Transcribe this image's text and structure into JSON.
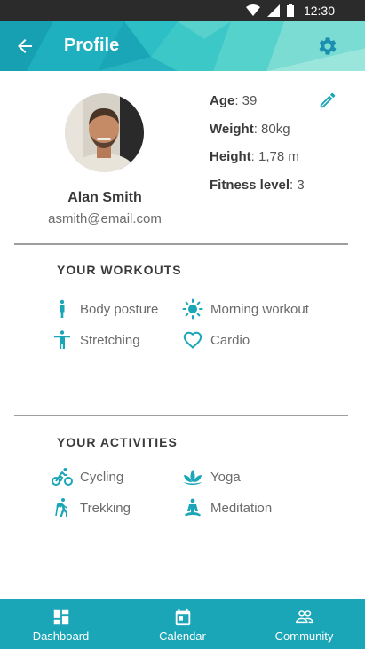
{
  "status_bar": {
    "time": "12:30"
  },
  "app_bar": {
    "title": "Profile"
  },
  "profile": {
    "name": "Alan Smith",
    "email": "asmith@email.com",
    "stats": [
      {
        "key": "Age",
        "value": ": 39"
      },
      {
        "key": "Weight",
        "value": ": 80kg"
      },
      {
        "key": "Height",
        "value": ": 1,78 m"
      },
      {
        "key": "Fitness level",
        "value": ": 3"
      }
    ]
  },
  "workouts": {
    "title": "YOUR WORKOUTS",
    "items": [
      {
        "label": "Body posture",
        "icon": "person-standing-icon"
      },
      {
        "label": "Morning workout",
        "icon": "sun-icon"
      },
      {
        "label": "Stretching",
        "icon": "person-arms-out-icon"
      },
      {
        "label": "Cardio",
        "icon": "heart-outline-icon"
      }
    ]
  },
  "activities": {
    "title": "YOUR ACTIVITIES",
    "items": [
      {
        "label": "Cycling",
        "icon": "bike-icon"
      },
      {
        "label": "Yoga",
        "icon": "lotus-icon"
      },
      {
        "label": "Trekking",
        "icon": "hiking-icon"
      },
      {
        "label": "Meditation",
        "icon": "meditation-icon"
      }
    ]
  },
  "bottom_nav": {
    "items": [
      {
        "label": "Dashboard",
        "icon": "dashboard-icon"
      },
      {
        "label": "Calendar",
        "icon": "calendar-icon"
      },
      {
        "label": "Community",
        "icon": "people-icon"
      }
    ]
  },
  "colors": {
    "accent": "#1aa6b7",
    "status_bar": "#2b2b2b",
    "text": "#6b6b6b",
    "divider": "#9e9e9e"
  }
}
